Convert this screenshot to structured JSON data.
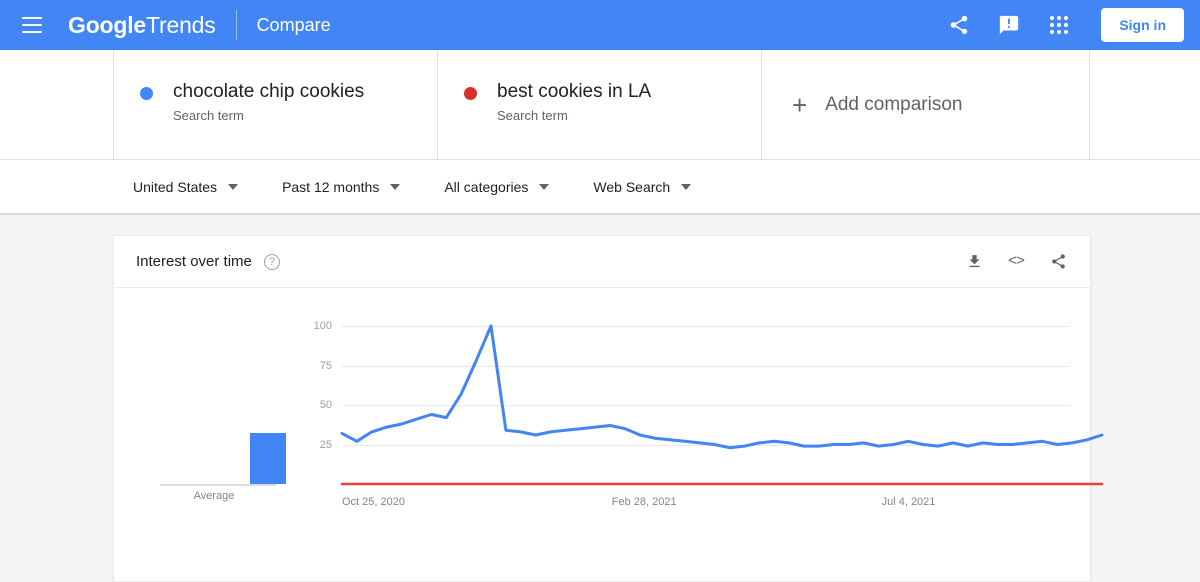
{
  "header": {
    "menu_icon": "hamburger-icon",
    "brand_bold": "Google",
    "brand_light": "Trends",
    "section": "Compare",
    "share_icon": "share-icon",
    "feedback_icon": "feedback-icon",
    "apps_icon": "apps-grid-icon",
    "signin_label": "Sign in"
  },
  "comparison": {
    "items": [
      {
        "term": "chocolate chip cookies",
        "type": "Search term",
        "color": "#4285f4"
      },
      {
        "term": "best cookies in LA",
        "type": "Search term",
        "color": "#d93025"
      }
    ],
    "add": {
      "plus": "+",
      "label": "Add comparison"
    }
  },
  "filters": [
    {
      "label": "United States"
    },
    {
      "label": "Past 12 months"
    },
    {
      "label": "All categories"
    },
    {
      "label": "Web Search"
    }
  ],
  "card": {
    "title": "Interest over time",
    "help": "?",
    "download_icon": "download-icon",
    "embed_icon": "embed-code-icon",
    "share_icon": "share-icon"
  },
  "chart_data": {
    "type": "line",
    "title": "Interest over time",
    "xlabel": "",
    "ylabel": "",
    "ylim": [
      0,
      100
    ],
    "yticks": [
      100,
      75,
      50,
      25
    ],
    "grid": true,
    "legend": "top",
    "average_label": "Average",
    "average_value": 32,
    "xticks": [
      {
        "label": "Oct 25, 2020",
        "pos": 0.0
      },
      {
        "label": "Feb 28, 2021",
        "pos": 0.355
      },
      {
        "label": "Jul 4, 2021",
        "pos": 0.71
      }
    ],
    "series": [
      {
        "name": "chocolate chip cookies",
        "color": "#4285f4",
        "values": [
          32,
          27,
          33,
          36,
          38,
          41,
          44,
          42,
          57,
          78,
          100,
          34,
          33,
          31,
          33,
          34,
          35,
          36,
          37,
          35,
          31,
          29,
          28,
          27,
          26,
          25,
          23,
          24,
          26,
          27,
          26,
          24,
          24,
          25,
          25,
          26,
          24,
          25,
          27,
          25,
          24,
          26,
          24,
          26,
          25,
          25,
          26,
          27,
          25,
          26,
          28,
          31
        ]
      },
      {
        "name": "best cookies in LA",
        "color": "#ea4335",
        "values": [
          0,
          0,
          0,
          0,
          0,
          0,
          0,
          0,
          0,
          0,
          0,
          0,
          0,
          0,
          0,
          0,
          0,
          0,
          0,
          0,
          0,
          0,
          0,
          0,
          0,
          0,
          0,
          0,
          0,
          0,
          0,
          0,
          0,
          0,
          0,
          0,
          0,
          0,
          0,
          0,
          0,
          0,
          0,
          0,
          0,
          0,
          0,
          0,
          0,
          0,
          0,
          0
        ]
      }
    ]
  }
}
